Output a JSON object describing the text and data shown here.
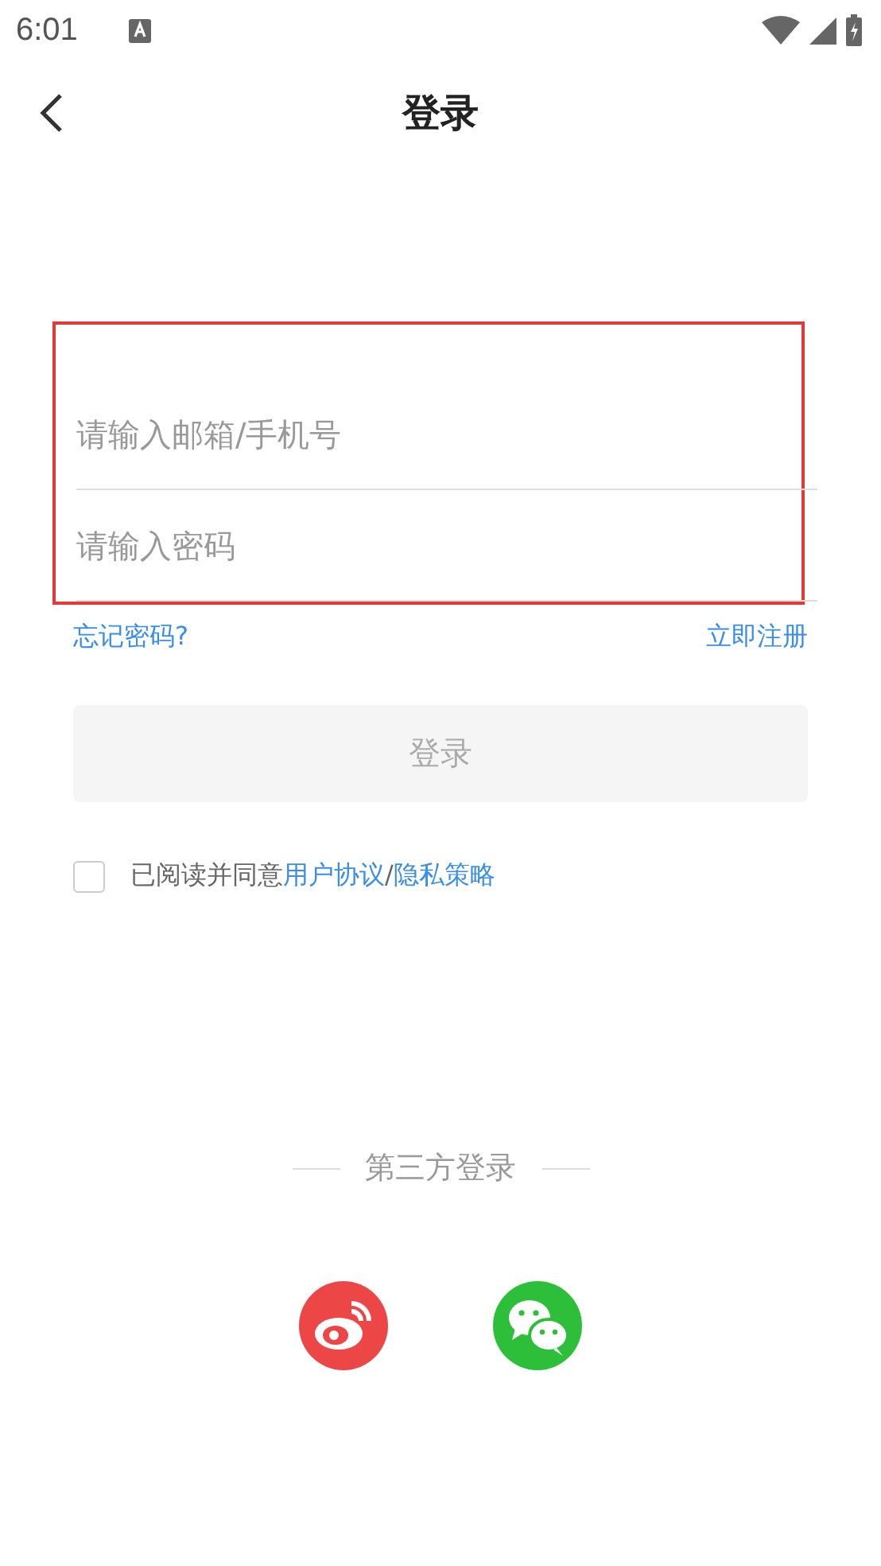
{
  "status_bar": {
    "time": "6:01"
  },
  "header": {
    "title": "登录"
  },
  "form": {
    "highlighted": true,
    "fields": [
      {
        "placeholder": "请输入邮箱/手机号"
      },
      {
        "placeholder": "请输入密码"
      }
    ]
  },
  "links": {
    "forgot": "忘记密码?",
    "register": "立即注册"
  },
  "login_button": {
    "label": "登录",
    "disabled": true
  },
  "agreement": {
    "checked": false,
    "text": "已阅读并同意",
    "links": [
      "用户协议",
      "隐私策略"
    ],
    "separator": "/"
  },
  "third_party": {
    "title": "第三方登录",
    "providers": [
      {
        "kind": "weibo"
      },
      {
        "kind": "wechat"
      }
    ]
  }
}
